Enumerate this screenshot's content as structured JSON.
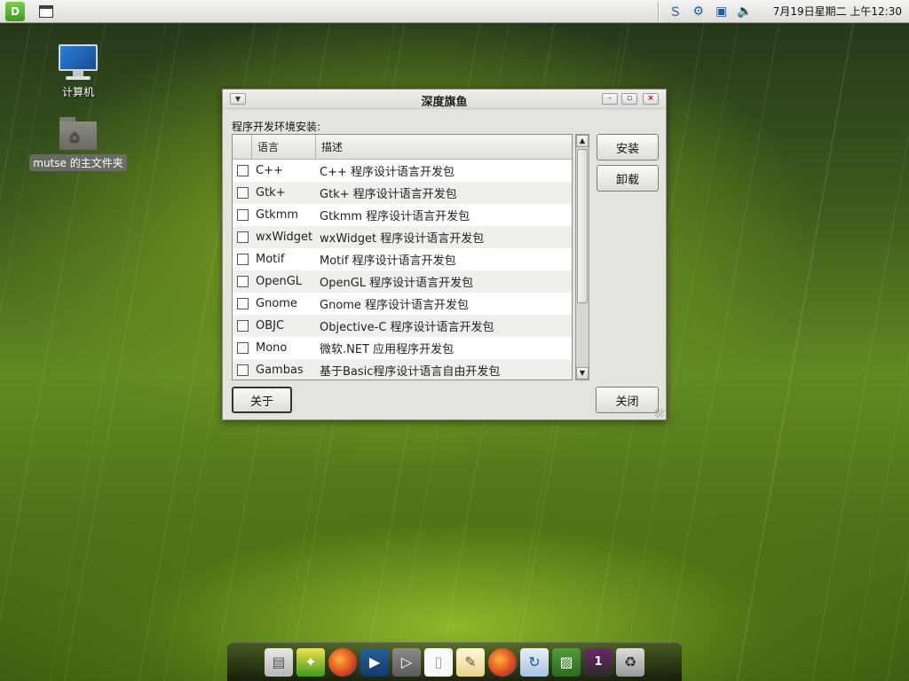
{
  "top_panel": {
    "logo_text": "D",
    "clock": "7月19日星期二 上午12:30",
    "tray_icons": [
      "skype-icon",
      "network-icon",
      "display-icon",
      "volume-icon"
    ]
  },
  "desktop": {
    "computer_label": "计算机",
    "home_folder_label": "mutse 的主文件夹"
  },
  "dialog": {
    "title": "深度旗鱼",
    "section_label": "程序开发环境安装:",
    "columns": {
      "language": "语言",
      "description": "描述"
    },
    "rows": [
      {
        "language": "C++",
        "description": "C++ 程序设计语言开发包",
        "checked": false
      },
      {
        "language": "Gtk+",
        "description": "Gtk+ 程序设计语言开发包",
        "checked": false
      },
      {
        "language": "Gtkmm",
        "description": "Gtkmm 程序设计语言开发包",
        "checked": false
      },
      {
        "language": "wxWidget",
        "description": "wxWidget 程序设计语言开发包",
        "checked": false
      },
      {
        "language": "Motif",
        "description": "Motif 程序设计语言开发包",
        "checked": false
      },
      {
        "language": "OpenGL",
        "description": "OpenGL 程序设计语言开发包",
        "checked": false
      },
      {
        "language": "Gnome",
        "description": "Gnome 程序设计语言开发包",
        "checked": false
      },
      {
        "language": "OBJC",
        "description": "Objective-C 程序设计语言开发包",
        "checked": false
      },
      {
        "language": "Mono",
        "description": "微软.NET 应用程序开发包",
        "checked": false
      },
      {
        "language": "Gambas",
        "description": "基于Basic程序设计语言自由开发包",
        "checked": false
      }
    ],
    "buttons": {
      "install": "安装",
      "uninstall": "卸载",
      "about": "关于",
      "close": "关闭"
    }
  },
  "dock": {
    "workspace_number": "1",
    "items": [
      "files-icon",
      "deepin-icon",
      "firefox-icon",
      "video-player-icon",
      "media-player-icon",
      "document-icon",
      "text-editor-icon",
      "firefox-icon",
      "updater-icon",
      "image-viewer-icon",
      "workspace-icon",
      "trash-icon"
    ]
  }
}
